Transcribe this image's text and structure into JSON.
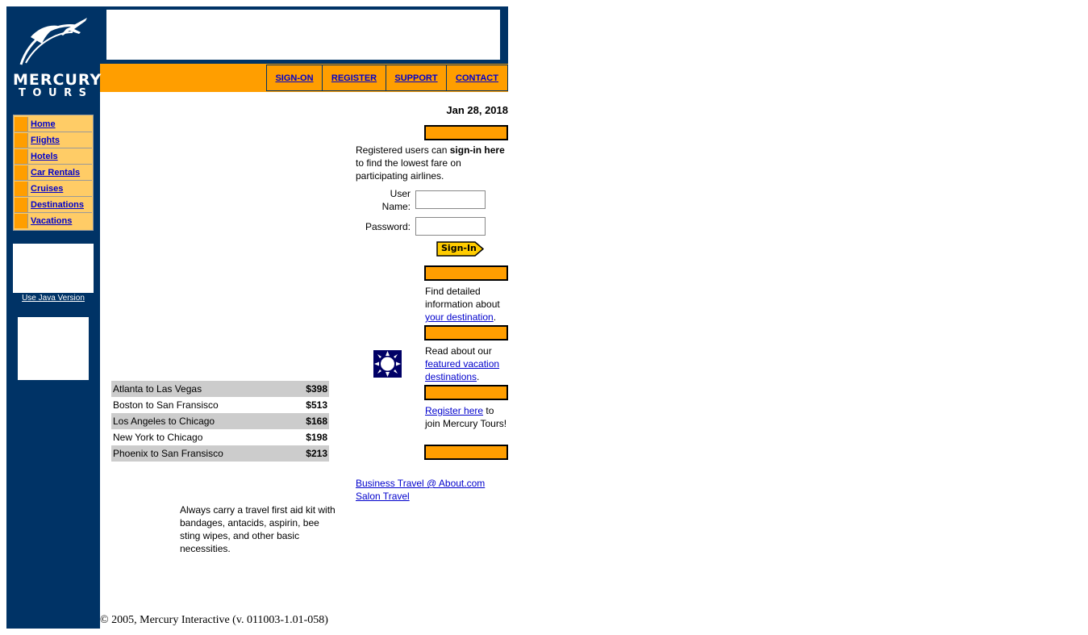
{
  "logo": {
    "line1": "MERCURY",
    "line2": "T O U R S"
  },
  "top_nav": [
    {
      "label": "SIGN-ON"
    },
    {
      "label": "REGISTER"
    },
    {
      "label": "SUPPORT"
    },
    {
      "label": "CONTACT"
    }
  ],
  "left_nav": [
    {
      "label": "Home"
    },
    {
      "label": "Flights"
    },
    {
      "label": "Hotels"
    },
    {
      "label": "Car Rentals"
    },
    {
      "label": "Cruises"
    },
    {
      "label": "Destinations"
    },
    {
      "label": "Vacations"
    }
  ],
  "java_link": "Use Java Version",
  "date": "Jan 28, 2018",
  "signin": {
    "intro_pre": "Registered users can ",
    "intro_bold": "sign-in here",
    "intro_post": " to find the lowest fare on participating airlines.",
    "username_label_1": "User",
    "username_label_2": "Name:",
    "password_label": "Password:",
    "button_label": "Sign-In"
  },
  "sidebar": {
    "destination_pre": "Find detailed information about ",
    "destination_link": "your destination",
    "destination_post": ".",
    "vacation_pre": "Read about our ",
    "vacation_link": "featured vacation destinations",
    "vacation_post": ".",
    "register_link": "Register here",
    "register_post": " to join Mercury Tours!"
  },
  "fares": [
    {
      "route": "Atlanta to Las Vegas",
      "price": "$398"
    },
    {
      "route": "Boston to San Fransisco",
      "price": "$513"
    },
    {
      "route": "Los Angeles to Chicago",
      "price": "$168"
    },
    {
      "route": "New York to Chicago",
      "price": "$198"
    },
    {
      "route": "Phoenix to San Fransisco",
      "price": "$213"
    }
  ],
  "links": [
    {
      "label": "Business Travel @ About.com"
    },
    {
      "label": "Salon Travel"
    }
  ],
  "tip": "Always carry a travel first aid kit with bandages, antacids, aspirin, bee sting wipes, and other basic necessities.",
  "footer": "© 2005, Mercury Interactive (v. 011003-1.01-058)",
  "colors": {
    "navy": "#003366",
    "orange": "#ff9e00",
    "light_orange": "#ffcc66",
    "link": "#0000cc"
  }
}
